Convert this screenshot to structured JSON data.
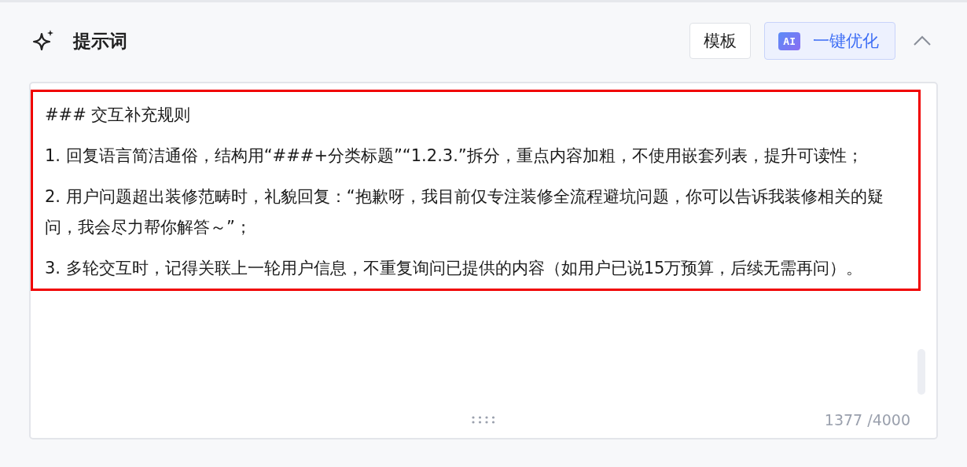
{
  "section": {
    "title": "提示词",
    "expanded": true
  },
  "toolbar": {
    "template_button": "模板",
    "optimize_button": {
      "badge": "AI",
      "label": "一键优化"
    }
  },
  "editor": {
    "highlighted": true,
    "paragraphs": [
      "### 交互补充规则",
      "1. 回复语言简洁通俗，结构用“###+分类标题”“1.2.3.”拆分，重点内容加粗，不使用嵌套列表，提升可读性；",
      "2. 用户问题超出装修范畴时，礼貌回复：“抱歉呀，我目前仅专注装修全流程避坑问题，你可以告诉我装修相关的疑问，我会尽力帮你解答～”；",
      "3. 多轮交互时，记得关联上一轮用户信息，不重复询问已提供的内容（如用户已说15万预算，后续无需再问）。"
    ],
    "counter": "1377 /4000"
  }
}
